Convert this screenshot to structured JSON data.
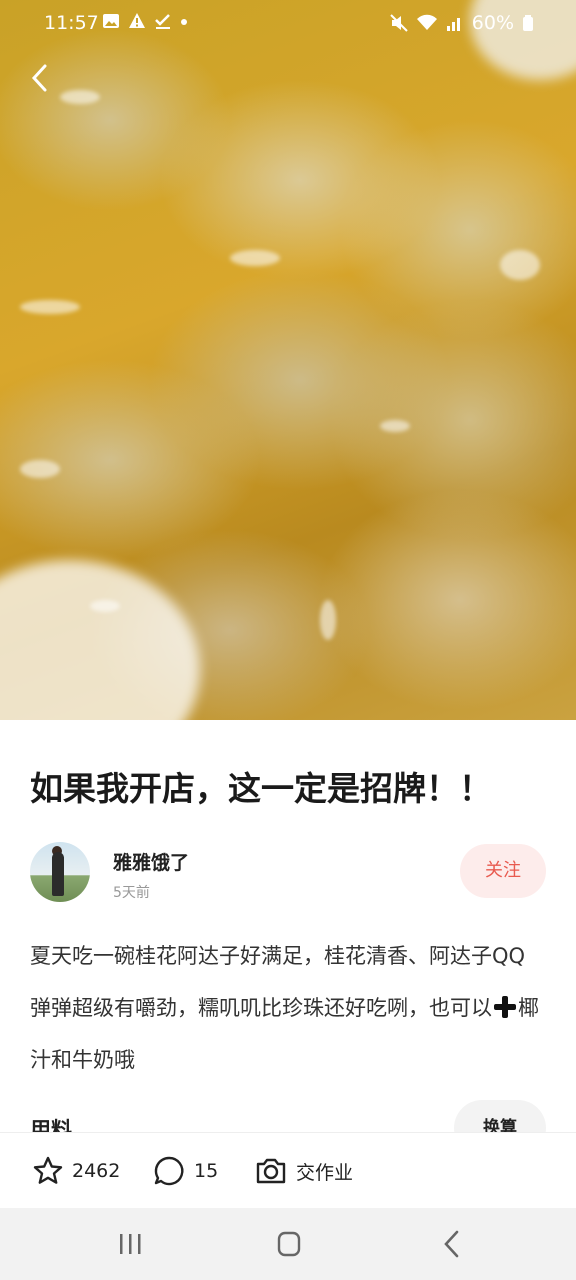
{
  "status_bar": {
    "time": "11:57",
    "battery": "60%"
  },
  "post": {
    "title": "如果我开店，这一定是招牌！！",
    "author": {
      "name": "雅雅饿了",
      "time": "5天前",
      "follow_label": "关注"
    },
    "description": {
      "part1": "夏天吃一碗桂花阿达子好满足，桂花清香、阿达子QQ弹弹超级有嚼劲，糯叽叽比珍珠还好吃咧，也可以",
      "part2": "椰汁和牛奶哦"
    },
    "ingredients_label": "用料",
    "convert_label": "换算"
  },
  "bottom_bar": {
    "favorites": "2462",
    "comments": "15",
    "homework_label": "交作业"
  },
  "colors": {
    "accent": "#e85a4f",
    "follow_bg": "#fdeceb"
  }
}
